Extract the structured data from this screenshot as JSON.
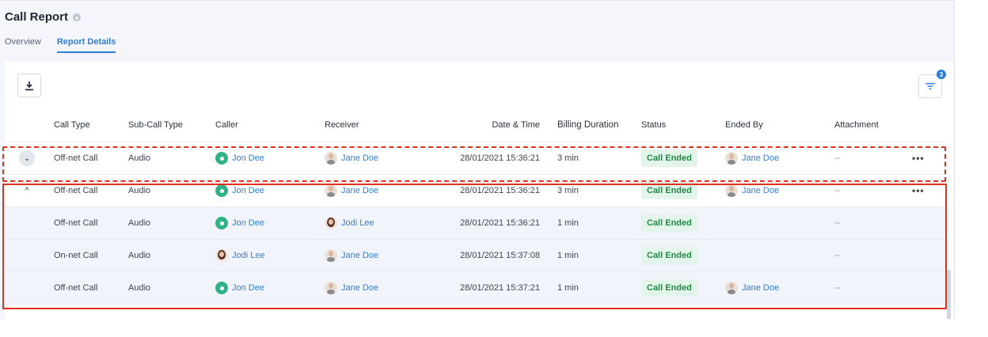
{
  "page": {
    "title": "Call Report"
  },
  "tabs": [
    {
      "label": "Overview",
      "active": false
    },
    {
      "label": "Report Details",
      "active": true
    }
  ],
  "toolbar": {
    "download_icon": "download-icon",
    "filter_icon": "filter-icon",
    "filter_count": "3"
  },
  "table": {
    "headers": {
      "call_type": "Call Type",
      "sub_call_type": "Sub-Call Type",
      "caller": "Caller",
      "receiver": "Receiver",
      "date_time": "Date & Time",
      "billing_duration": "Billing Duration",
      "status": "Status",
      "ended_by": "Ended By",
      "attachment": "Attachment"
    },
    "rows": [
      {
        "chevron": "⌄",
        "call_type": "Off-net Call",
        "sub_call_type": "Audio",
        "caller": "Jon Dee",
        "receiver": "Jane Doe",
        "date_time": "28/01/2021  15:36:21",
        "billing_duration": "3 min",
        "status": "Call Ended",
        "ended_by": "Jane Doe",
        "attachment": "--",
        "more": "•••"
      },
      {
        "chevron": "^",
        "call_type": "Off-net Call",
        "sub_call_type": "Audio",
        "caller": "Jon Dee",
        "receiver": "Jane Doe",
        "date_time": "28/01/2021  15:36:21",
        "billing_duration": "3 min",
        "status": "Call Ended",
        "ended_by": "Jane Doe",
        "attachment": "--",
        "more": "•••"
      },
      {
        "call_type": "Off-net Call",
        "sub_call_type": "Audio",
        "caller": "Jon Dee",
        "receiver": "Jodi Lee",
        "date_time": "28/01/2021  15:36:21",
        "billing_duration": "1 min",
        "status": "Call Ended",
        "attachment": "--"
      },
      {
        "call_type": "On-net Call",
        "sub_call_type": "Audio",
        "caller": "Jodi Lee",
        "receiver": "Jane Doe",
        "date_time": "28/01/2021  15:37:08",
        "billing_duration": "1 min",
        "status": "Call Ended",
        "attachment": "--"
      },
      {
        "call_type": "Off-net Call",
        "sub_call_type": "Audio",
        "caller": "Jon Dee",
        "receiver": "Jane Doe",
        "date_time": "28/01/2021  15:37:21",
        "billing_duration": "1 min",
        "status": "Call Ended",
        "ended_by": "Jane Doe",
        "attachment": "--"
      }
    ]
  },
  "colors": {
    "accent": "#2b7fd8",
    "status_bg": "#e3f5ea",
    "status_text": "#1f8a45",
    "highlight": "#e0301e"
  }
}
